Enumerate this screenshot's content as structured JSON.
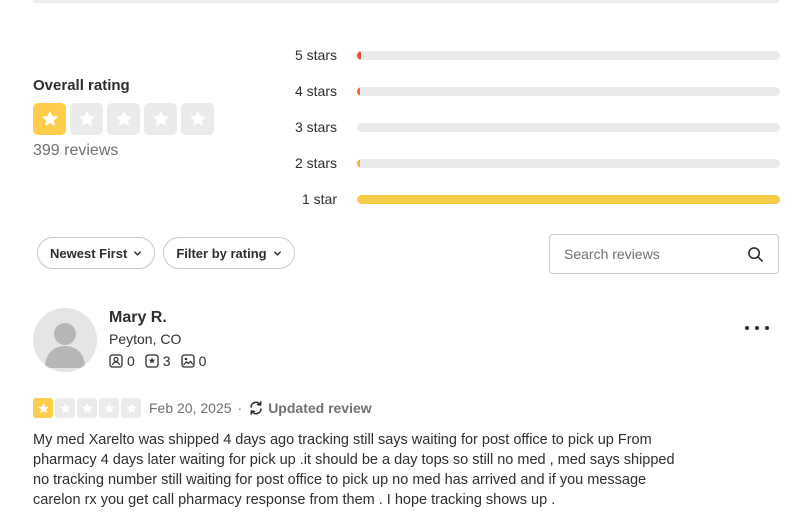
{
  "colors": {
    "star_fill": "#ffcc4b",
    "star_empty": "#ebebeb",
    "bar_5": "#e8503a",
    "bar_4": "#f16c3a",
    "bar_2": "#f5b23f",
    "bar_1": "#f8ca4a"
  },
  "overall": {
    "label": "Overall rating",
    "rating": 1,
    "max_rating": 5,
    "reviews_text": "399 reviews"
  },
  "distribution": [
    {
      "label": "5 stars",
      "fraction": 0.01
    },
    {
      "label": "4 stars",
      "fraction": 0.004
    },
    {
      "label": "3 stars",
      "fraction": 0.0
    },
    {
      "label": "2 stars",
      "fraction": 0.008
    },
    {
      "label": "1 star",
      "fraction": 1.0
    }
  ],
  "controls": {
    "sort_label": "Newest First",
    "filter_label": "Filter by rating",
    "search_placeholder": "Search reviews"
  },
  "review": {
    "name": "Mary R.",
    "location": "Peyton, CO",
    "friends": "0",
    "reviews": "3",
    "photos": "0",
    "rating": 1,
    "date": "Feb 20, 2025",
    "separator": "·",
    "updated_label": "Updated review",
    "text": "My med Xarelto was shipped 4 days ago tracking still says waiting for post office to pick up From pharmacy 4 days later waiting for pick up .it should be a day tops so still no med , med says shipped no tracking number still waiting for post office to pick up no med has arrived and if you message carelon rx you get call pharmacy response from them . I hope tracking shows up ."
  },
  "icons": {
    "star": "star-icon",
    "chevron": "chevron-down-icon",
    "search": "search-icon",
    "friends": "friends-icon",
    "reviews": "review-star-icon",
    "photos": "photo-icon",
    "updated": "refresh-icon",
    "more": "more-options-icon"
  }
}
